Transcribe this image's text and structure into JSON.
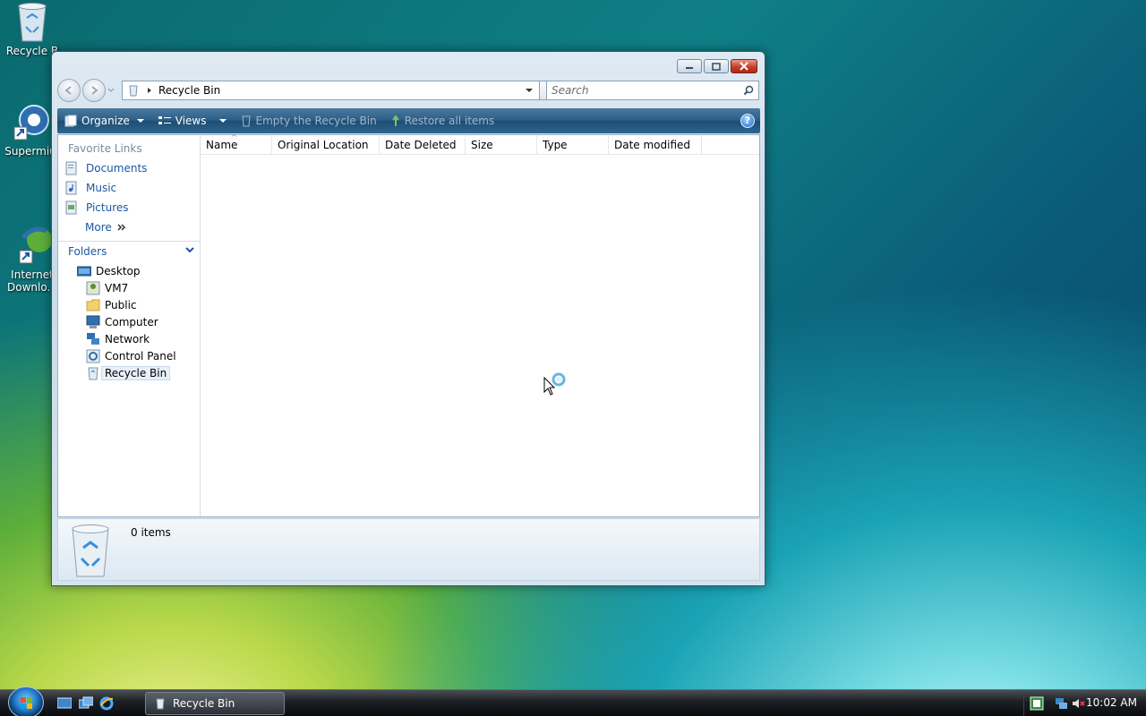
{
  "desktop": {
    "icons": [
      {
        "label": "Recycle B",
        "icon": "recycle-bin-icon"
      },
      {
        "label": "Supermiu",
        "icon": "browser-globe-icon"
      },
      {
        "label": "Internet\nDownlo...",
        "icon": "download-manager-icon"
      }
    ]
  },
  "window": {
    "title": "Recycle Bin",
    "address": {
      "crumb": "Recycle Bin"
    },
    "search": {
      "placeholder": "Search"
    },
    "toolbar": {
      "organize": "Organize",
      "views": "Views",
      "empty": "Empty the Recycle Bin",
      "restore": "Restore all items",
      "help": "?"
    },
    "nav": {
      "favorites_header": "Favorite Links",
      "favorites": [
        "Documents",
        "Music",
        "Pictures"
      ],
      "more": "More",
      "folders_header": "Folders",
      "tree": [
        {
          "label": "Desktop",
          "icon": "desktop-icon"
        },
        {
          "label": "VM7",
          "icon": "user-folder-icon"
        },
        {
          "label": "Public",
          "icon": "folder-icon"
        },
        {
          "label": "Computer",
          "icon": "computer-icon"
        },
        {
          "label": "Network",
          "icon": "network-icon"
        },
        {
          "label": "Control Panel",
          "icon": "control-panel-icon"
        },
        {
          "label": "Recycle Bin",
          "icon": "recycle-bin-icon",
          "selected": true
        }
      ]
    },
    "columns": [
      "Name",
      "Original Location",
      "Date Deleted",
      "Size",
      "Type",
      "Date modified"
    ],
    "details": {
      "count": "0 items"
    }
  },
  "taskbar": {
    "task_button": "Recycle Bin",
    "clock": "10:02 AM"
  },
  "colors": {
    "toolbar": "#2b5d86",
    "link": "#1b57a3"
  }
}
